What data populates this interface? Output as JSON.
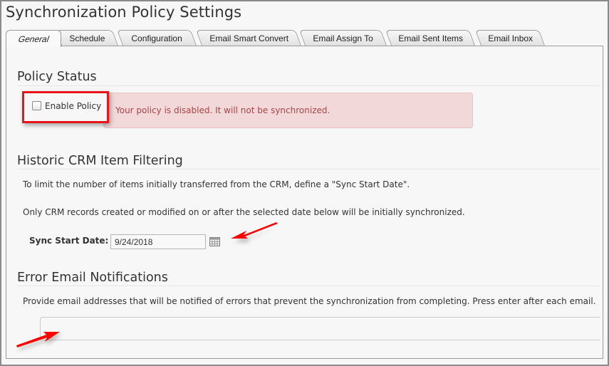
{
  "page": {
    "title": "Synchronization Policy Settings"
  },
  "tabs": [
    {
      "label": "General",
      "active": true
    },
    {
      "label": "Schedule",
      "active": false
    },
    {
      "label": "Configuration",
      "active": false
    },
    {
      "label": "Email Smart Convert",
      "active": false
    },
    {
      "label": "Email Assign To",
      "active": false
    },
    {
      "label": "Email Sent Items",
      "active": false
    },
    {
      "label": "Email Inbox",
      "active": false
    }
  ],
  "policy_status": {
    "heading": "Policy Status",
    "enable_checkbox_label": "Enable Policy",
    "enabled": false,
    "alert_text": "Your policy is disabled. It will not be synchronized.",
    "alert_color": "#a94446",
    "alert_bg": "#f2d8d9"
  },
  "historic": {
    "heading": "Historic CRM Item Filtering",
    "description1": "To limit the number of items initially transferred from the CRM, define a \"Sync Start Date\".",
    "description2": "Only CRM records created or modified on or after the selected date below will be initially synchronized.",
    "date_label": "Sync Start Date:",
    "date_value": "9/24/2018",
    "calendar_icon": "calendar-icon"
  },
  "error_email": {
    "heading": "Error Email Notifications",
    "description": "Provide email addresses that will be notified of errors that prevent the synchronization from completing. Press enter after each email.",
    "emails_value": ""
  },
  "annotations": {
    "highlight_color": "#e8141a",
    "arrow_color": "#ff0000"
  }
}
